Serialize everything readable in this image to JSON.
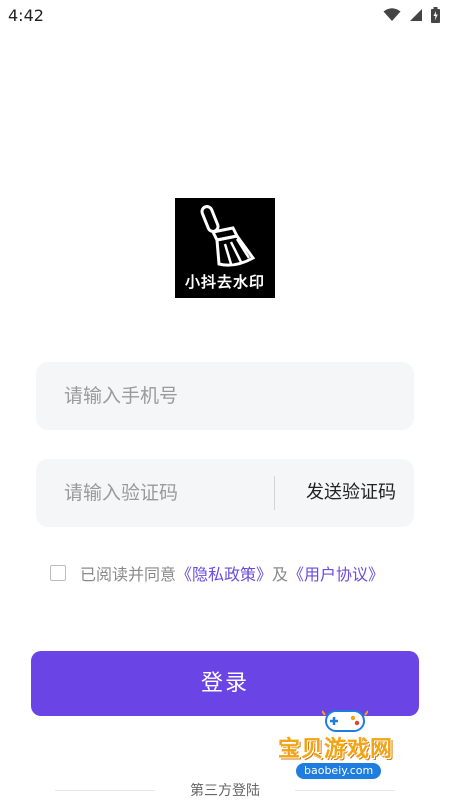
{
  "status_bar": {
    "time": "4:42",
    "icons": [
      "wifi-icon",
      "signal-icon",
      "battery-icon"
    ]
  },
  "logo": {
    "icon": "brush-icon",
    "text": "小抖去水印"
  },
  "phone": {
    "placeholder": "请输入手机号",
    "value": ""
  },
  "code": {
    "placeholder": "请输入验证码",
    "value": "",
    "send_label": "发送验证码"
  },
  "agreement": {
    "checked": false,
    "prefix": "已阅读并同意",
    "privacy_link": "《隐私政策》",
    "joiner": "及",
    "terms_link": "《用户协议》"
  },
  "login": {
    "label": "登录"
  },
  "third_party": {
    "label": "第三方登陆"
  },
  "watermark": {
    "title": "宝贝游戏网",
    "url": "baobeiy.com"
  },
  "colors": {
    "accent": "#6b44e6",
    "link": "#6a4ce0",
    "field_bg": "#f5f6f8",
    "logo_bg": "#000000"
  }
}
